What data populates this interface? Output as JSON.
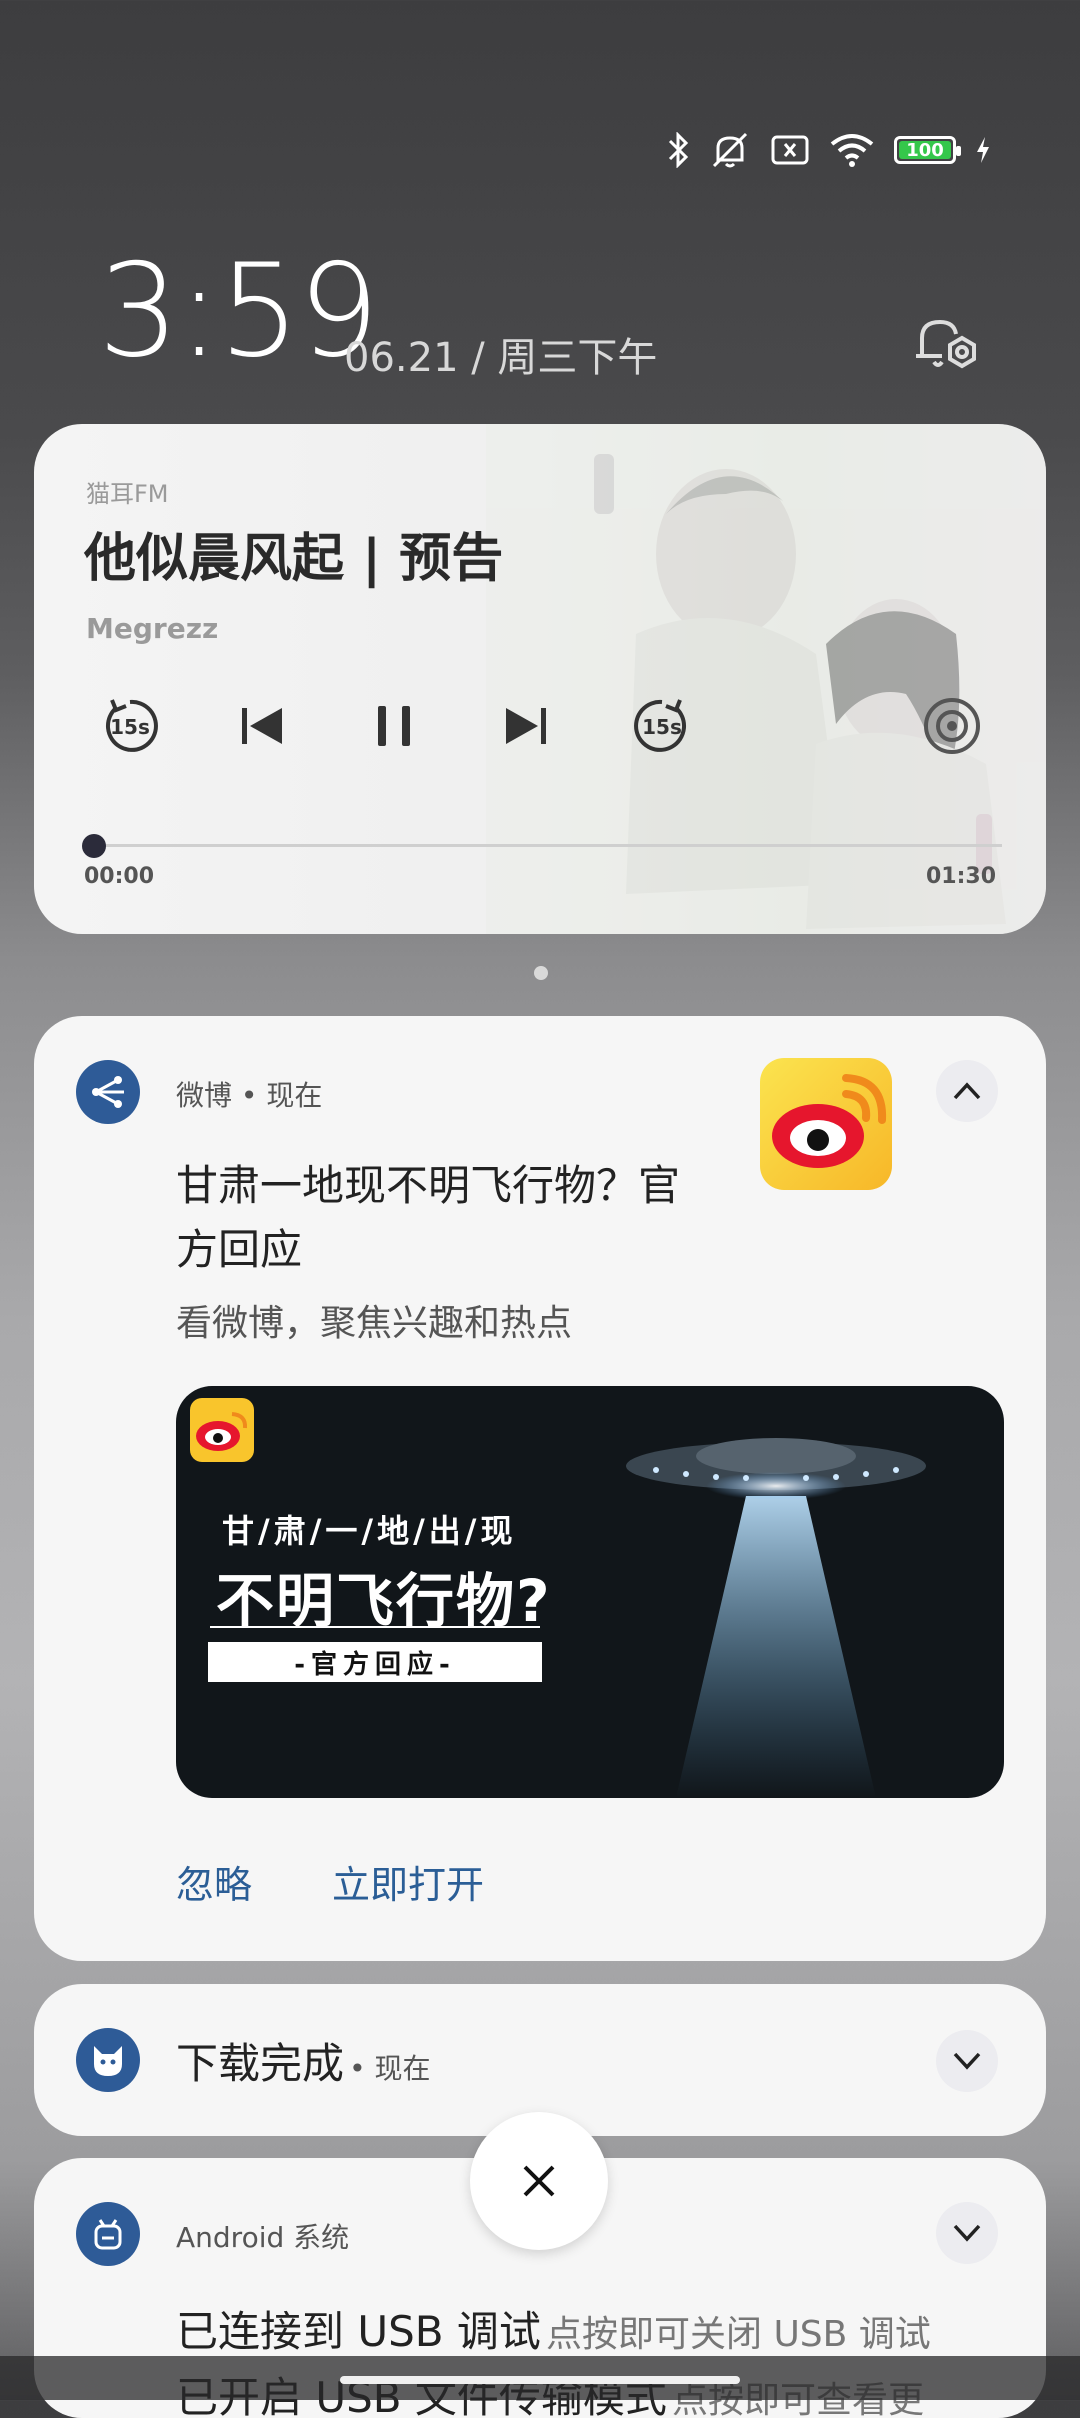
{
  "status_bar": {
    "battery_level": "100",
    "icons": [
      "bluetooth-icon",
      "silent-icon",
      "no-sim-icon",
      "wifi-icon",
      "battery-icon",
      "charging-icon"
    ]
  },
  "lockscreen": {
    "time": "3:59",
    "date": "06.21 / 周三下午"
  },
  "media": {
    "app": "猫耳FM",
    "title": "他似晨风起 | 预告",
    "artist": "Megrezz",
    "rewind_label": "15s",
    "forward_label": "15s",
    "elapsed": "00:00",
    "duration": "01:30",
    "progress": 0.0
  },
  "weibo_notification": {
    "app_name": "微博",
    "time": "现在",
    "title": "甘肃一地现不明飞行物？官方回应",
    "title_line1": "甘肃一地现不明飞行物？官",
    "title_line2": "方回应",
    "subtitle": "看微博，聚焦兴趣和热点",
    "banner": {
      "line1": "甘/肃/一/地/出/现",
      "line2": "不明飞行物?",
      "line3": "-官方回应-"
    },
    "actions": {
      "ignore": "忽略",
      "open": "立即打开"
    }
  },
  "download_notification": {
    "title": "下载完成",
    "time": "现在"
  },
  "android_notification": {
    "app_name": "Android 系统",
    "line1_bold": "已连接到 USB 调试",
    "line1_sub": "点按即可关闭 USB 调试",
    "line2_bold": "已开启 USB 文件传输模式",
    "line2_sub": "点按即可查看更"
  },
  "colors": {
    "accent_blue": "#2b5e96",
    "app_icon_blue": "#2e5b97",
    "weibo_yellow": "#f9c52c",
    "weibo_red": "#e6162d"
  }
}
